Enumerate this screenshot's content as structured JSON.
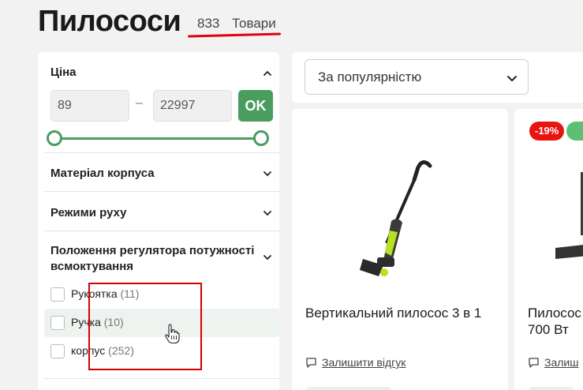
{
  "header": {
    "title": "Пилососи",
    "count": "833",
    "count_label": "Товари"
  },
  "filters": {
    "price": {
      "title": "Ціна",
      "min_value": "89",
      "separator": "–",
      "max_value": "22997",
      "ok_label": "OK"
    },
    "sections": [
      {
        "title": "Матеріал корпуса"
      },
      {
        "title": "Режими руху"
      },
      {
        "title": "Положення регулятора потужності всмоктування"
      }
    ],
    "options": [
      {
        "label": "Рукоятка",
        "count": "(11)"
      },
      {
        "label": "Ручка",
        "count": "(10)"
      },
      {
        "label": "корпус",
        "count": "(252)"
      }
    ]
  },
  "sort": {
    "selected": "За популярністю"
  },
  "products": [
    {
      "name": "Вертикальний пилосос 3 в 1",
      "review_label": "Залишити відгук"
    },
    {
      "name": "Пилосос\n700 Вт",
      "review_label": "Залиш",
      "badge": "-19%"
    }
  ],
  "colors": {
    "accent_green": "#4a9d5f",
    "sale_red": "#e8140f",
    "highlight_red": "#d40000"
  }
}
